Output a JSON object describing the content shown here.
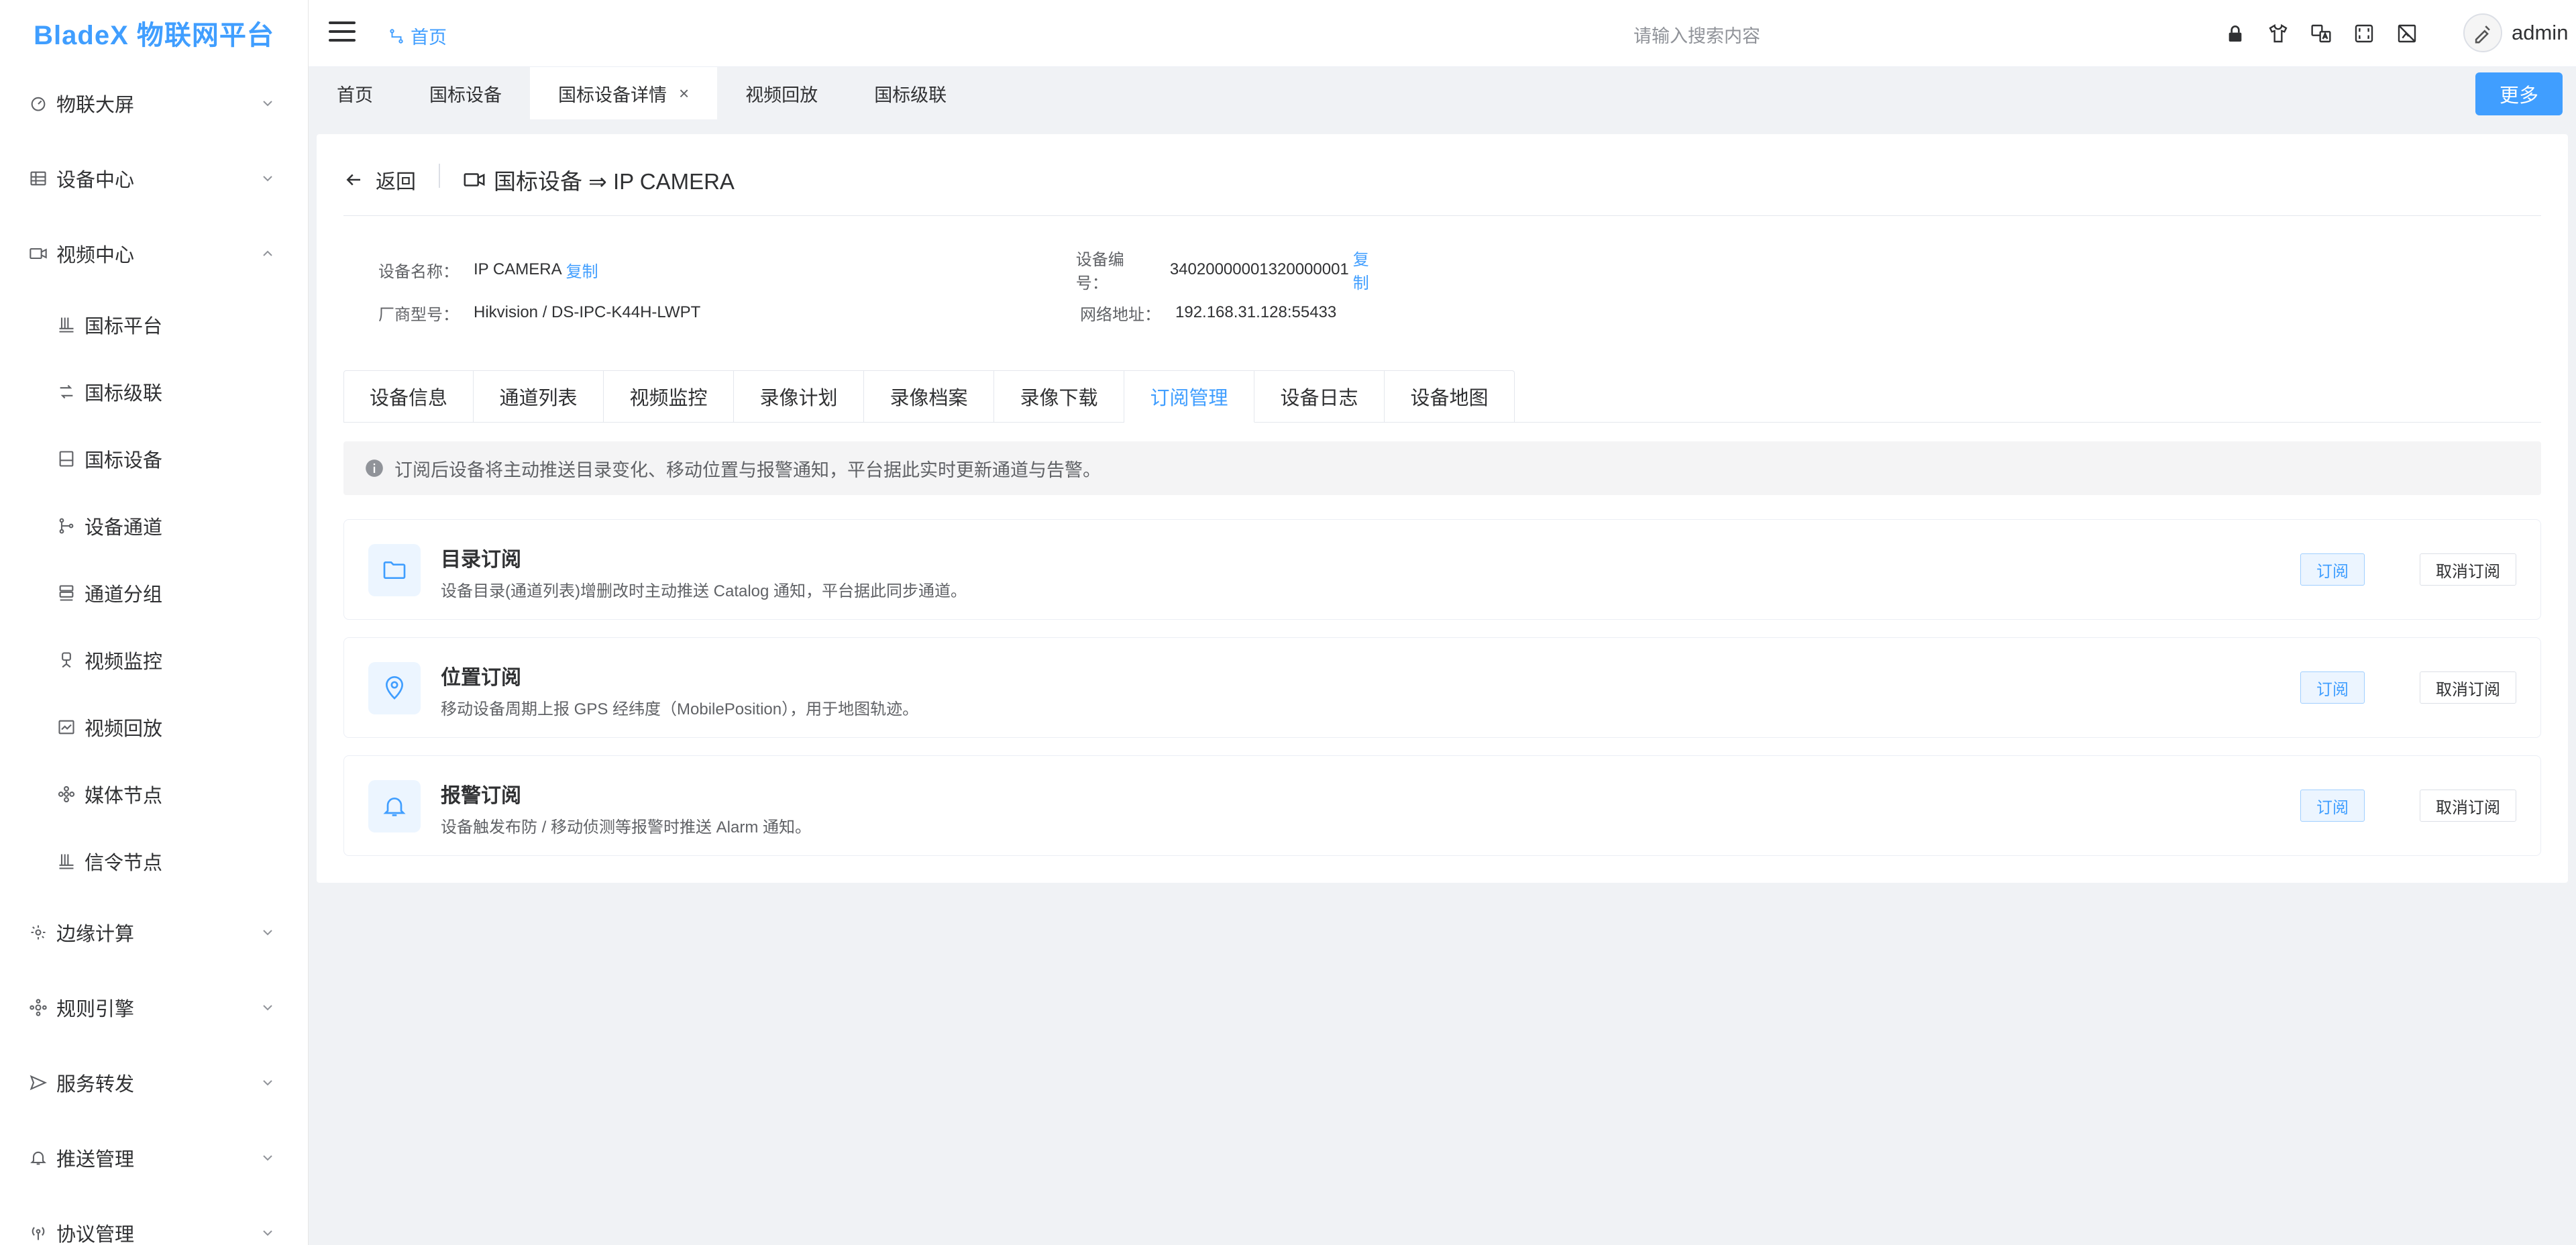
{
  "app": {
    "logo": "BladeX 物联网平台"
  },
  "sidebar": {
    "items": [
      {
        "label": "物联大屏",
        "icon": "dashboard-icon",
        "expanded": false
      },
      {
        "label": "设备中心",
        "icon": "device-center-icon",
        "expanded": false
      },
      {
        "label": "视频中心",
        "icon": "video-icon",
        "expanded": true,
        "children": [
          {
            "label": "国标平台",
            "icon": "platform-icon"
          },
          {
            "label": "国标级联",
            "icon": "cascade-icon"
          },
          {
            "label": "国标设备",
            "icon": "device-icon"
          },
          {
            "label": "设备通道",
            "icon": "channel-icon"
          },
          {
            "label": "通道分组",
            "icon": "group-icon"
          },
          {
            "label": "视频监控",
            "icon": "monitor-icon"
          },
          {
            "label": "视频回放",
            "icon": "playback-icon"
          },
          {
            "label": "媒体节点",
            "icon": "media-node-icon"
          },
          {
            "label": "信令节点",
            "icon": "signal-node-icon"
          }
        ]
      },
      {
        "label": "边缘计算",
        "icon": "edge-icon",
        "expanded": false
      },
      {
        "label": "规则引擎",
        "icon": "rule-icon",
        "expanded": false
      },
      {
        "label": "服务转发",
        "icon": "forward-icon",
        "expanded": false
      },
      {
        "label": "推送管理",
        "icon": "bell-icon",
        "expanded": false
      },
      {
        "label": "协议管理",
        "icon": "protocol-icon",
        "expanded": false
      }
    ]
  },
  "header": {
    "breadcrumb_home": "首页",
    "search_placeholder": "请输入搜索内容",
    "icons": [
      "lock-icon",
      "shirt-icon",
      "translate-icon",
      "fullscreen-icon",
      "image-off-icon"
    ],
    "user": "admin"
  },
  "tags": {
    "items": [
      {
        "label": "首页",
        "active": false
      },
      {
        "label": "国标设备",
        "active": false
      },
      {
        "label": "国标设备详情",
        "active": true
      },
      {
        "label": "视频回放",
        "active": false
      },
      {
        "label": "国标级联",
        "active": false
      }
    ],
    "more_label": "更多"
  },
  "page": {
    "back_label": "返回",
    "title": "国标设备 ⇒ IP CAMERA",
    "info": {
      "name_key": "设备名称：",
      "name_val": "IP CAMERA",
      "code_key": "设备编号：",
      "code_val": "34020000001320000001",
      "vendor_key": "厂商型号：",
      "vendor_val": "Hikvision / DS-IPC-K44H-LWPT",
      "addr_key": "网络地址：",
      "addr_val": "192.168.31.128:55433",
      "copy_label": "复制"
    },
    "tabs": [
      "设备信息",
      "通道列表",
      "视频监控",
      "录像计划",
      "录像档案",
      "录像下载",
      "订阅管理",
      "设备日志",
      "设备地图"
    ],
    "active_tab": "订阅管理",
    "notice": "订阅后设备将主动推送目录变化、移动位置与报警通知，平台据此实时更新通道与告警。",
    "subscriptions": [
      {
        "title": "目录订阅",
        "desc": "设备目录(通道列表)增删改时主动推送 Catalog 通知，平台据此同步通道。",
        "icon": "folder-icon"
      },
      {
        "title": "位置订阅",
        "desc": "移动设备周期上报 GPS 经纬度（MobilePosition），用于地图轨迹。",
        "icon": "location-icon"
      },
      {
        "title": "报警订阅",
        "desc": "设备触发布防 / 移动侦测等报警时推送 Alarm 通知。",
        "icon": "bell-icon"
      }
    ],
    "subscribe_label": "订阅",
    "unsubscribe_label": "取消订阅"
  },
  "colors": {
    "primary": "#409eff",
    "text": "#303133",
    "muted": "#606266",
    "bg": "#f0f2f5"
  }
}
